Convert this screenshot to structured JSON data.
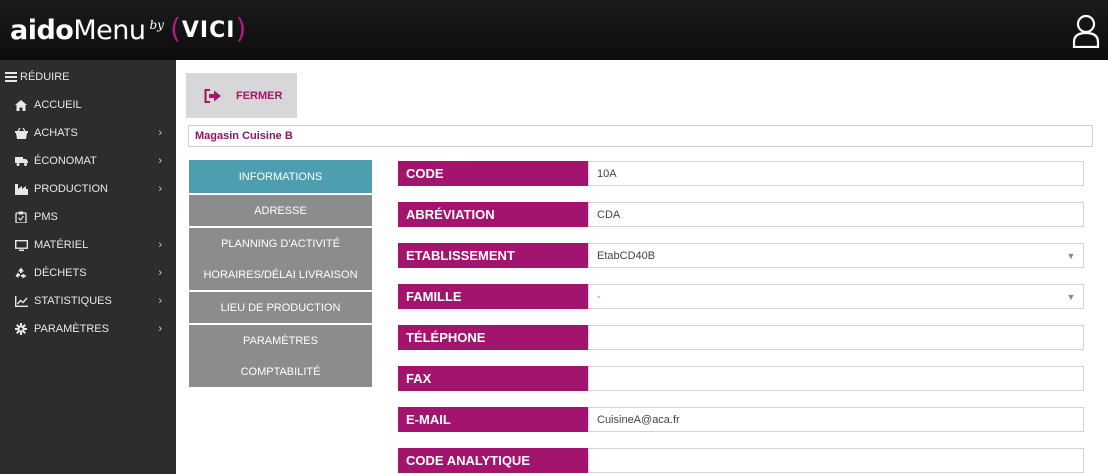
{
  "header": {
    "logo_aido": "aido",
    "logo_menu": "Menu",
    "logo_by": "by",
    "logo_vici": "VICI"
  },
  "sidebar": {
    "reduce_label": "RÉDUIRE",
    "items": [
      {
        "label": "ACCUEIL",
        "icon": "home-icon",
        "has_submenu": false
      },
      {
        "label": "ACHATS",
        "icon": "basket-icon",
        "has_submenu": true
      },
      {
        "label": "ÉCONOMAT",
        "icon": "truck-icon",
        "has_submenu": true
      },
      {
        "label": "PRODUCTION",
        "icon": "factory-icon",
        "has_submenu": true
      },
      {
        "label": "PMS",
        "icon": "clipboard-icon",
        "has_submenu": false
      },
      {
        "label": "MATÉRIEL",
        "icon": "monitor-icon",
        "has_submenu": true
      },
      {
        "label": "DÉCHETS",
        "icon": "recycle-icon",
        "has_submenu": true
      },
      {
        "label": "STATISTIQUES",
        "icon": "line-chart-icon",
        "has_submenu": true
      },
      {
        "label": "PARAMÈTRES",
        "icon": "gear-icon",
        "has_submenu": true
      }
    ]
  },
  "actions": {
    "close_label": "FERMER"
  },
  "store_name": "Magasin Cuisine B",
  "tabs": [
    {
      "label": "INFORMATIONS",
      "active": true
    },
    {
      "label": "ADRESSE",
      "active": false
    },
    {
      "label": "PLANNING D'ACTIVITÉ",
      "active": false
    },
    {
      "label": "HORAIRES/DÉLAI LIVRAISON",
      "active": false
    },
    {
      "label": "LIEU DE PRODUCTION",
      "active": false
    },
    {
      "label": "PARAMÈTRES",
      "active": false
    },
    {
      "label": "COMPTABILITÉ",
      "active": false
    }
  ],
  "form": {
    "fields": [
      {
        "label": "CODE",
        "value": "10A",
        "type": "text"
      },
      {
        "label": "ABRÉVIATION",
        "value": "CDA",
        "type": "text"
      },
      {
        "label": "ETABLISSEMENT",
        "value": "EtabCD40B",
        "type": "select"
      },
      {
        "label": "FAMILLE",
        "value": "-",
        "type": "select"
      },
      {
        "label": "TÉLÉPHONE",
        "value": "",
        "type": "text"
      },
      {
        "label": "FAX",
        "value": "",
        "type": "text"
      },
      {
        "label": "E-MAIL",
        "value": "CuisineA@aca.fr",
        "type": "text"
      },
      {
        "label": "CODE ANALYTIQUE",
        "value": "",
        "type": "text"
      }
    ]
  },
  "colors": {
    "brand": "#a3146e",
    "active_tab": "#4d9eb1",
    "inactive_tab": "#8c8c8c",
    "sidebar_bg": "#2d2d2d",
    "topbar_bg": "#121212"
  }
}
